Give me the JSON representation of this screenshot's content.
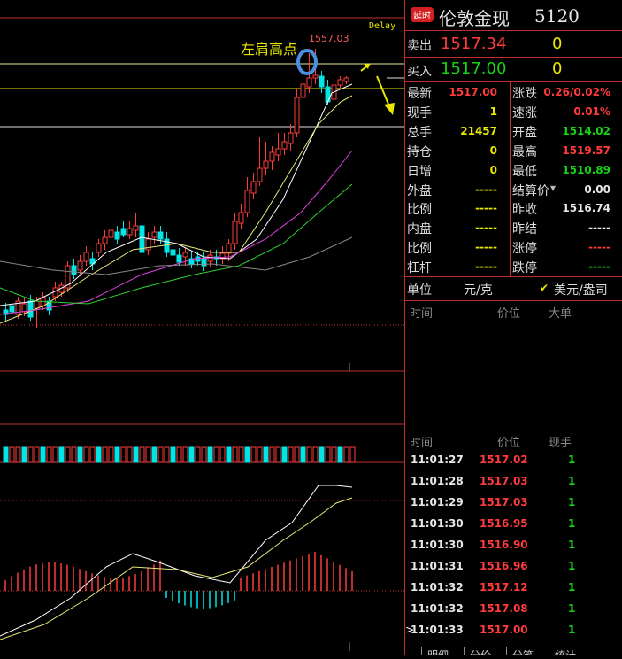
{
  "chart": {
    "annotation": "左肩高点",
    "high_label": "1557.03",
    "delay_label": "Delay"
  },
  "header": {
    "badge": "延时",
    "name": "伦敦金现",
    "code": "5120"
  },
  "bidask": {
    "sell_label": "卖出",
    "sell_price": "1517.34",
    "sell_vol": "0",
    "buy_label": "买入",
    "buy_price": "1517.00",
    "buy_vol": "0"
  },
  "stats": [
    {
      "l1": "最新",
      "v1": "1517.00",
      "c1": "red",
      "l2": "涨跌",
      "v2": "0.26/0.02%",
      "c2": "red"
    },
    {
      "l1": "现手",
      "v1": "1",
      "c1": "yel",
      "l2": "速涨",
      "v2": "0.01%",
      "c2": "red"
    },
    {
      "l1": "总手",
      "v1": "21457",
      "c1": "yel",
      "l2": "开盘",
      "v2": "1514.02",
      "c2": "green"
    },
    {
      "l1": "持仓",
      "v1": "0",
      "c1": "yel",
      "l2": "最高",
      "v2": "1519.57",
      "c2": "red"
    },
    {
      "l1": "日增",
      "v1": "0",
      "c1": "yel",
      "l2": "最低",
      "v2": "1510.89",
      "c2": "green"
    },
    {
      "l1": "外盘",
      "v1": "-----",
      "c1": "yel",
      "l2": "结算价",
      "v2": "0.00",
      "c2": "wht"
    },
    {
      "l1": "比例",
      "v1": "-----",
      "c1": "yel",
      "l2": "昨收",
      "v2": "1516.74",
      "c2": "wht"
    },
    {
      "l1": "内盘",
      "v1": "-----",
      "c1": "yel",
      "l2": "昨结",
      "v2": "-----",
      "c2": "wht"
    },
    {
      "l1": "比例",
      "v1": "-----",
      "c1": "yel",
      "l2": "涨停",
      "v2": "-----",
      "c2": "red"
    },
    {
      "l1": "杠杆",
      "v1": "-----",
      "c1": "yel",
      "l2": "跌停",
      "v2": "-----",
      "c2": "green"
    }
  ],
  "units": {
    "label": "单位",
    "unit1": "元/克",
    "check": "✔",
    "unit2": "美元/盎司"
  },
  "big_orders": {
    "col_time": "时间",
    "col_price": "价位",
    "col_vol": "大单"
  },
  "ticks": {
    "col_time": "时间",
    "col_price": "价位",
    "col_vol": "现手",
    "rows": [
      {
        "time": "11:01:27",
        "price": "1517.02",
        "vol": "1"
      },
      {
        "time": "11:01:28",
        "price": "1517.03",
        "vol": "1"
      },
      {
        "time": "11:01:29",
        "price": "1517.03",
        "vol": "1"
      },
      {
        "time": "11:01:30",
        "price": "1516.95",
        "vol": "1"
      },
      {
        "time": "11:01:30",
        "price": "1516.90",
        "vol": "1"
      },
      {
        "time": "11:01:31",
        "price": "1516.96",
        "vol": "1"
      },
      {
        "time": "11:01:32",
        "price": "1517.12",
        "vol": "1"
      },
      {
        "time": "11:01:32",
        "price": "1517.08",
        "vol": "1"
      },
      {
        "time": "11:01:33",
        "price": "1517.00",
        "vol": "1"
      }
    ],
    "cursor": ">"
  },
  "bottom_tabs": [
    "明细",
    "分价",
    "分笔",
    "统计"
  ],
  "colors": {
    "up": "#ff3b3b",
    "down": "#00e5e5",
    "border": "#c0302a",
    "ma5": "#ffffff",
    "ma10": "#e8e87a",
    "ma20": "#e040e0",
    "ma60": "#30d030",
    "ma120": "#888888"
  }
}
